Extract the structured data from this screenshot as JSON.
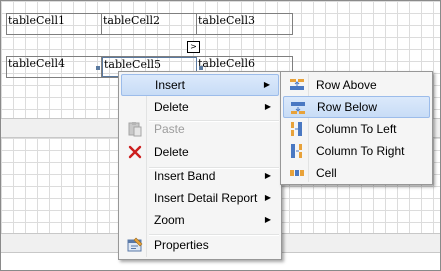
{
  "designer": {
    "table1": {
      "cells": [
        "tableCell1",
        "tableCell2",
        "tableCell3"
      ]
    },
    "table2": {
      "cells": [
        "tableCell4",
        "tableCell5",
        "tableCell6"
      ]
    },
    "smart_tag_glyph": ">"
  },
  "context_menu": {
    "items": [
      {
        "label": "Insert",
        "has_submenu": true,
        "highlighted": true,
        "icon": ""
      },
      {
        "label": "Delete",
        "has_submenu": true,
        "icon": ""
      },
      {
        "label": "Paste",
        "disabled": true,
        "icon": "paste-icon"
      },
      {
        "label": "Delete",
        "icon": "delete-x-icon"
      },
      {
        "label": "Insert Band",
        "has_submenu": true,
        "icon": ""
      },
      {
        "label": "Insert Detail Report",
        "has_submenu": true,
        "icon": ""
      },
      {
        "label": "Zoom",
        "has_submenu": true,
        "icon": ""
      },
      {
        "label": "Properties",
        "icon": "properties-icon"
      }
    ],
    "arrow_glyph": "▶"
  },
  "insert_submenu": {
    "items": [
      {
        "label": "Row Above",
        "icon": "row-above-icon"
      },
      {
        "label": "Row Below",
        "icon": "row-below-icon",
        "highlighted": true
      },
      {
        "label": "Column To Left",
        "icon": "column-left-icon"
      },
      {
        "label": "Column To Right",
        "icon": "column-right-icon"
      },
      {
        "label": "Cell",
        "icon": "cell-icon"
      }
    ]
  },
  "colors": {
    "highlight_top": "#dbe9fb",
    "highlight_bottom": "#c8dcf6",
    "delete_red": "#cc1f1f",
    "icon_orange": "#e8a23a",
    "icon_blue": "#4a78c2"
  }
}
